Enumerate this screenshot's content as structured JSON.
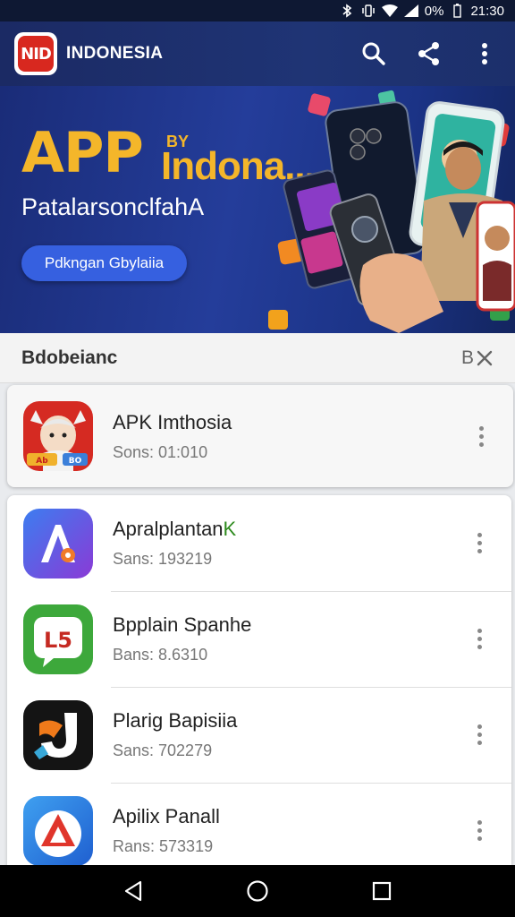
{
  "status_bar": {
    "battery": "0%",
    "time": "21:30",
    "icons": [
      "bluetooth-icon",
      "vibrate-icon",
      "wifi-icon",
      "signal-icon"
    ]
  },
  "app_bar": {
    "logo_text": "NID",
    "title": "INDONESIA",
    "actions": [
      "search-icon",
      "share-icon",
      "more-vert-icon"
    ]
  },
  "banner": {
    "title": "APP",
    "by": "BY",
    "brand": "Indona...",
    "subtitle": "PatalarsonclfahA",
    "cta_label": "Pdkngan Gbylaiia"
  },
  "section": {
    "title": "Bdobeianc",
    "close_label": "B"
  },
  "featured": {
    "name": "APK Imthosia",
    "meta": "Sons: 01:010",
    "icon_badge": "Ab",
    "icon_tag": "BO"
  },
  "apps": [
    {
      "name": "Apralplantan",
      "name_accent": "K",
      "meta": "Sans: 193219",
      "icon": "a-logo-icon"
    },
    {
      "name": "Bpplain Spanhe",
      "meta": "Bans: 8.6310",
      "icon_text": "L5",
      "icon": "l5-logo-icon"
    },
    {
      "name": "Plarig Bapisiia",
      "meta": "Sans: 702279",
      "icon": "j-logo-icon"
    },
    {
      "name": "Apilix Panall",
      "meta": "Rans: 573319",
      "icon": "triangle-logo-icon"
    }
  ],
  "colors": {
    "app_bar": "#1f3475",
    "banner_accent": "#f4b62a",
    "cta": "#3660e0",
    "accent_green": "#2e8b1e"
  }
}
